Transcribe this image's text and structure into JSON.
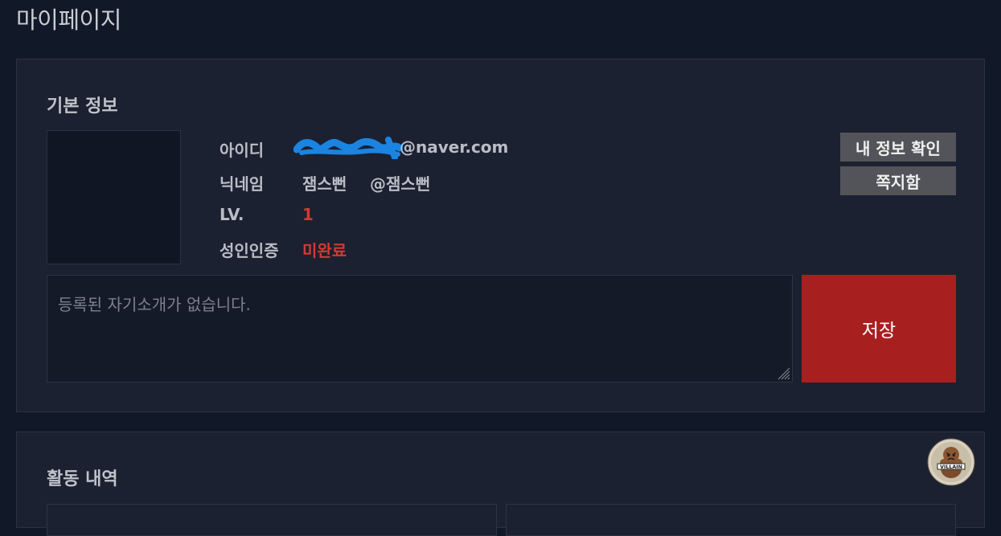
{
  "page": {
    "title": "마이페이지"
  },
  "basic": {
    "title": "기본 정보",
    "id_label": "아이디",
    "id_suffix": "@naver.com",
    "nick_label": "닉네임",
    "nick_value": "잼스뻔",
    "nick_handle": "@잼스뻔",
    "level_label": "LV.",
    "level_value": "1",
    "adult_label": "성인인증",
    "adult_value": "미완료",
    "btn_myinfo": "내 정보 확인",
    "btn_message": "쪽지함",
    "intro_placeholder": "등록된 자기소개가 없습니다.",
    "save_label": "저장"
  },
  "activity": {
    "title": "활동 내역"
  },
  "mascot": {
    "text": "VILLAIN"
  },
  "colors": {
    "background": "#111827",
    "card": "#1b2130",
    "accent_red": "#a81f1f",
    "status_red": "#d23a33",
    "button_gray": "#525459",
    "redaction_blue": "#1a84e0"
  }
}
